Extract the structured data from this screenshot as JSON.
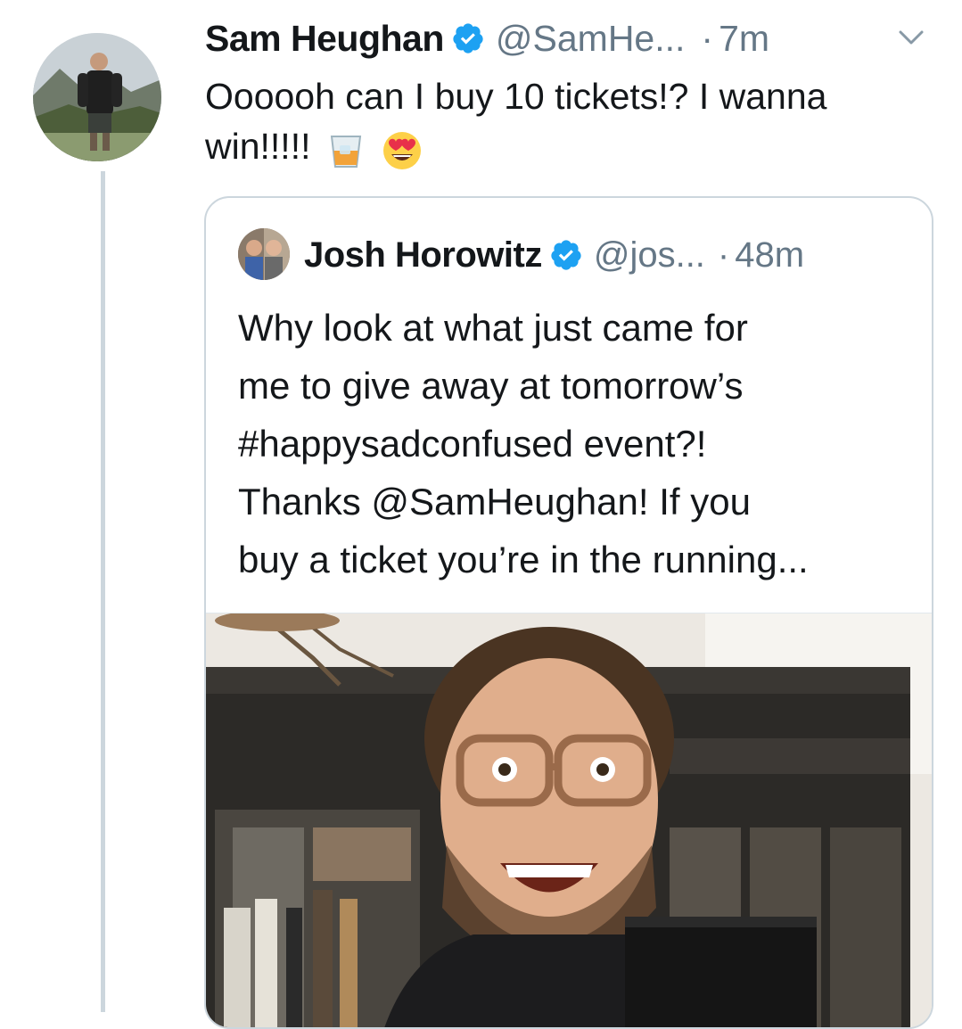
{
  "tweet": {
    "author_name": "Sam Heughan",
    "author_handle": "@SamHe...",
    "separator": "·",
    "time": "7m",
    "text": "Oooooh can I buy 10 tickets!? I wanna win!!!!!",
    "emojis": [
      "tumbler-glass-emoji",
      "heart-eyes-emoji"
    ]
  },
  "quoted_tweet": {
    "author_name": "Josh Horowitz",
    "author_handle": "@jos...",
    "separator": "·",
    "time": "48m",
    "lines": [
      "Why look at what just came for",
      "me to give away at tomorrow’s",
      "#happysadconfused event?!",
      "Thanks @SamHeughan! If you",
      "buy a ticket you’re in the running..."
    ]
  },
  "icons": {
    "verified": "verified-badge-icon",
    "caret": "chevron-down-icon"
  },
  "colors": {
    "verified_blue": "#1da1f2",
    "secondary_text": "#657786",
    "thread_line": "#ccd6dd"
  }
}
